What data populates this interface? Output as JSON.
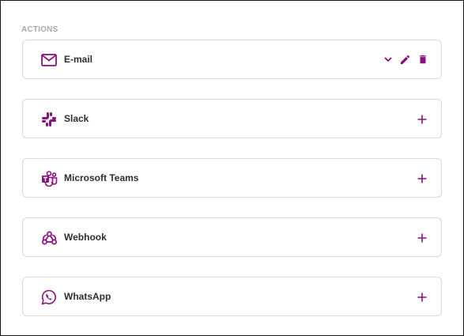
{
  "section": {
    "label": "ACTIONS"
  },
  "accent_color": "#8c0f7f",
  "actions": [
    {
      "label": "E-mail",
      "icon": "mail-icon",
      "expanded_controls": [
        "chevron-down-icon",
        "pencil-icon",
        "trash-icon"
      ]
    },
    {
      "label": "Slack",
      "icon": "slack-icon",
      "control": "plus-icon"
    },
    {
      "label": "Microsoft Teams",
      "icon": "teams-icon",
      "control": "plus-icon"
    },
    {
      "label": "Webhook",
      "icon": "webhook-icon",
      "control": "plus-icon"
    },
    {
      "label": "WhatsApp",
      "icon": "whatsapp-icon",
      "control": "plus-icon"
    }
  ]
}
